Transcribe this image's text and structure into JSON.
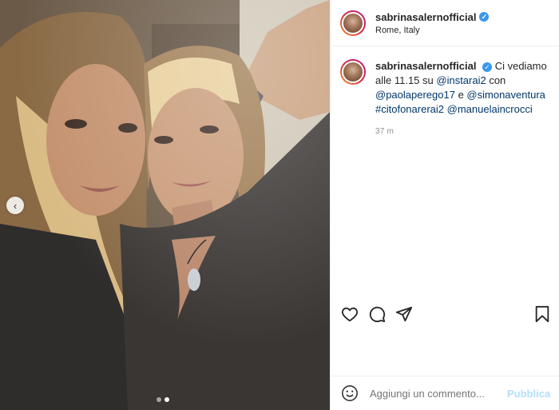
{
  "post": {
    "username": "sabrinasalernofficial",
    "location": "Rome, Italy",
    "caption": {
      "username": "sabrinasalernofficial",
      "text_1": "Ci vediamo alle 11.15 su ",
      "mention_1": "@instarai2",
      "text_2": " con ",
      "mention_2": "@paolaperego17",
      "text_3": " e ",
      "mention_3": "@simonaventura",
      "hashtag_1": "#citofonarerai2",
      "mention_4": "@manuelaincrocci"
    },
    "time": "37 m",
    "comment_placeholder": "Aggiungi un commento...",
    "publish_label": "Pubblica"
  },
  "icons": {
    "verified": "verified-badge",
    "like": "heart-icon",
    "comment": "comment-icon",
    "share": "share-icon",
    "save": "bookmark-icon",
    "emoji": "emoji-icon",
    "prev": "chevron-left-icon"
  },
  "colors": {
    "verified": "#3897f0",
    "mention": "#00376b",
    "publish": "#b2dffc"
  }
}
